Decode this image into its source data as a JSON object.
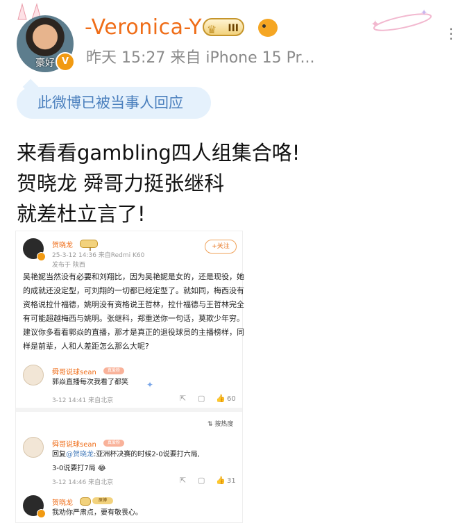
{
  "header": {
    "username": "-Veronica-Y",
    "vip_level": "III",
    "meta": "昨天 15:27  来自 iPhone 15 Pr...",
    "avatar_overlay": "豪好",
    "verified_mark": "V",
    "more_icon": "⋮"
  },
  "reply_tag": "此微博已被当事人回应",
  "post_lines": [
    "来看看gambling四人组集合咯!",
    "贺晓龙 舜哥力挺张继科",
    "就差杜立言了!"
  ],
  "embedded": {
    "author": "贺晓龙",
    "author_level": "II",
    "meta1": "25-3-12 14:36  来自Redmi K60",
    "meta2": "发布于 陕西",
    "follow_label": "+关注",
    "body": "吴艳妮当然没有必要和刘翔比，因为吴艳妮是女的，还是现役，她的成就还没定型，可刘翔的一切都已经定型了。就如同，梅西没有资格说拉什福德，姚明没有资格说王哲林，拉什福德与王哲林完全有可能超越梅西与姚明。张继科，郑重送你一句话，莫欺少年穷。建议你多看看郭焱的直播，那才是真正的退役球员的主播榜样，同样是前辈，人和人差距怎么那么大呢?",
    "comment1": {
      "author": "舜哥说球sean",
      "tag": "真爱粉",
      "text": "郭焱直播每次我看了都笑",
      "meta": "3-12 14:41  来自北京",
      "likes": "60"
    },
    "sort_label": "按热度",
    "comment2": {
      "author": "舜哥说球sean",
      "tag": "真爱粉",
      "line1_prefix": "回复",
      "line1_link": "@贺晓龙",
      "line1_rest": ":亚洲杯决赛的时候2-0说要打六局,",
      "line2": "3-0说要打7局",
      "meta": "3-12 14:46  来自北京",
      "likes": "31"
    },
    "comment3": {
      "author": "贺晓龙",
      "tag": "原博",
      "text": "我劝你严肃点，要有敬畏心。"
    }
  }
}
